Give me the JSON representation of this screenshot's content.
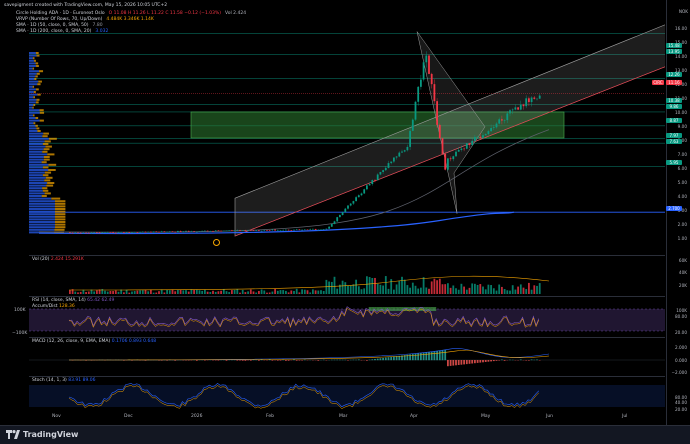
{
  "header": {
    "caption": "savepigment created with TradingView.com, May 15, 2026 10:05 UTC+2"
  },
  "legend": {
    "symbol": "Circle Holding ADA · 1D · Euronext Oslo",
    "ohlc": "O 11.08 H 11.26 L 11.22 C 11.58 −0.12 (−1.03%)",
    "vol": "Vol 2.424",
    "vrvp": "VRVP (Number Of Rows, 70, Up/Down)",
    "vrvp_vals": "4.484K  3.346K  1.14K",
    "sma50": "SMA · 1D (50, close, 0, SMA, 50)",
    "sma50_val": "7.80",
    "sma200": "SMA · 1D (200, close, 0, SMA, 20)",
    "sma200_val": "3.032"
  },
  "currency": "NOK",
  "price_ticks": [
    "16.00",
    "15.00",
    "14.00",
    "13.00",
    "12.00",
    "11.00",
    "10.00",
    "9.00",
    "8.00",
    "7.00",
    "6.00",
    "5.00",
    "4.00",
    "3.00",
    "2.00",
    "1.00"
  ],
  "price_labels": [
    {
      "text": "15.48",
      "color": "#089981"
    },
    {
      "text": "13.95",
      "color": "#089981"
    },
    {
      "text": "12.26",
      "color": "#089981"
    },
    {
      "text": "11.16",
      "color": "#f23645"
    },
    {
      "text": "10.38",
      "color": "#089981"
    },
    {
      "text": "9.86",
      "color": "#089981"
    },
    {
      "text": "8.87",
      "color": "#089981"
    },
    {
      "text": "7.97",
      "color": "#089981"
    },
    {
      "text": "7.63",
      "color": "#089981"
    },
    {
      "text": "5.95",
      "color": "#089981"
    },
    {
      "text": "2.700",
      "color": "#2962ff"
    }
  ],
  "symbol_tag": "CIRC",
  "vol_pane": {
    "label": "Vol (20)",
    "vals": "2.424  15.291K",
    "ticks": [
      "60K",
      "40K",
      "20K"
    ]
  },
  "rsi_pane": {
    "label": "RSI (14, close, SMA, 14)",
    "vals": "65.42  62.49",
    "label2": "Accum/Dist",
    "vals2": "128.36",
    "ticks": [
      "100K",
      "80.00",
      "20.00"
    ]
  },
  "rsi_left": {
    "top": "100K",
    "bottom": "−100K"
  },
  "macd_pane": {
    "label": "MACD (12, 26, close, 9, EMA, EMA)",
    "vals": "0.1706  0.893  0.648",
    "ticks": [
      "2.000",
      "0.000",
      "−2.000"
    ]
  },
  "stoch_pane": {
    "label": "Stoch (14, 1, 3)",
    "vals": "83.91  89.06",
    "ticks": [
      "80.00",
      "40.00",
      "20.00"
    ]
  },
  "time_axis": [
    "Nov",
    "Dec",
    "2026",
    "Feb",
    "Mar",
    "Apr",
    "May",
    "Jun",
    "Jul"
  ],
  "brand": "TradingView",
  "colors": {
    "up": "#089981",
    "down": "#f23645",
    "sma50": "#5d606b",
    "sma200": "#2962ff",
    "zone": "#2e7d32",
    "rsi_band": "#7e57c2"
  }
}
